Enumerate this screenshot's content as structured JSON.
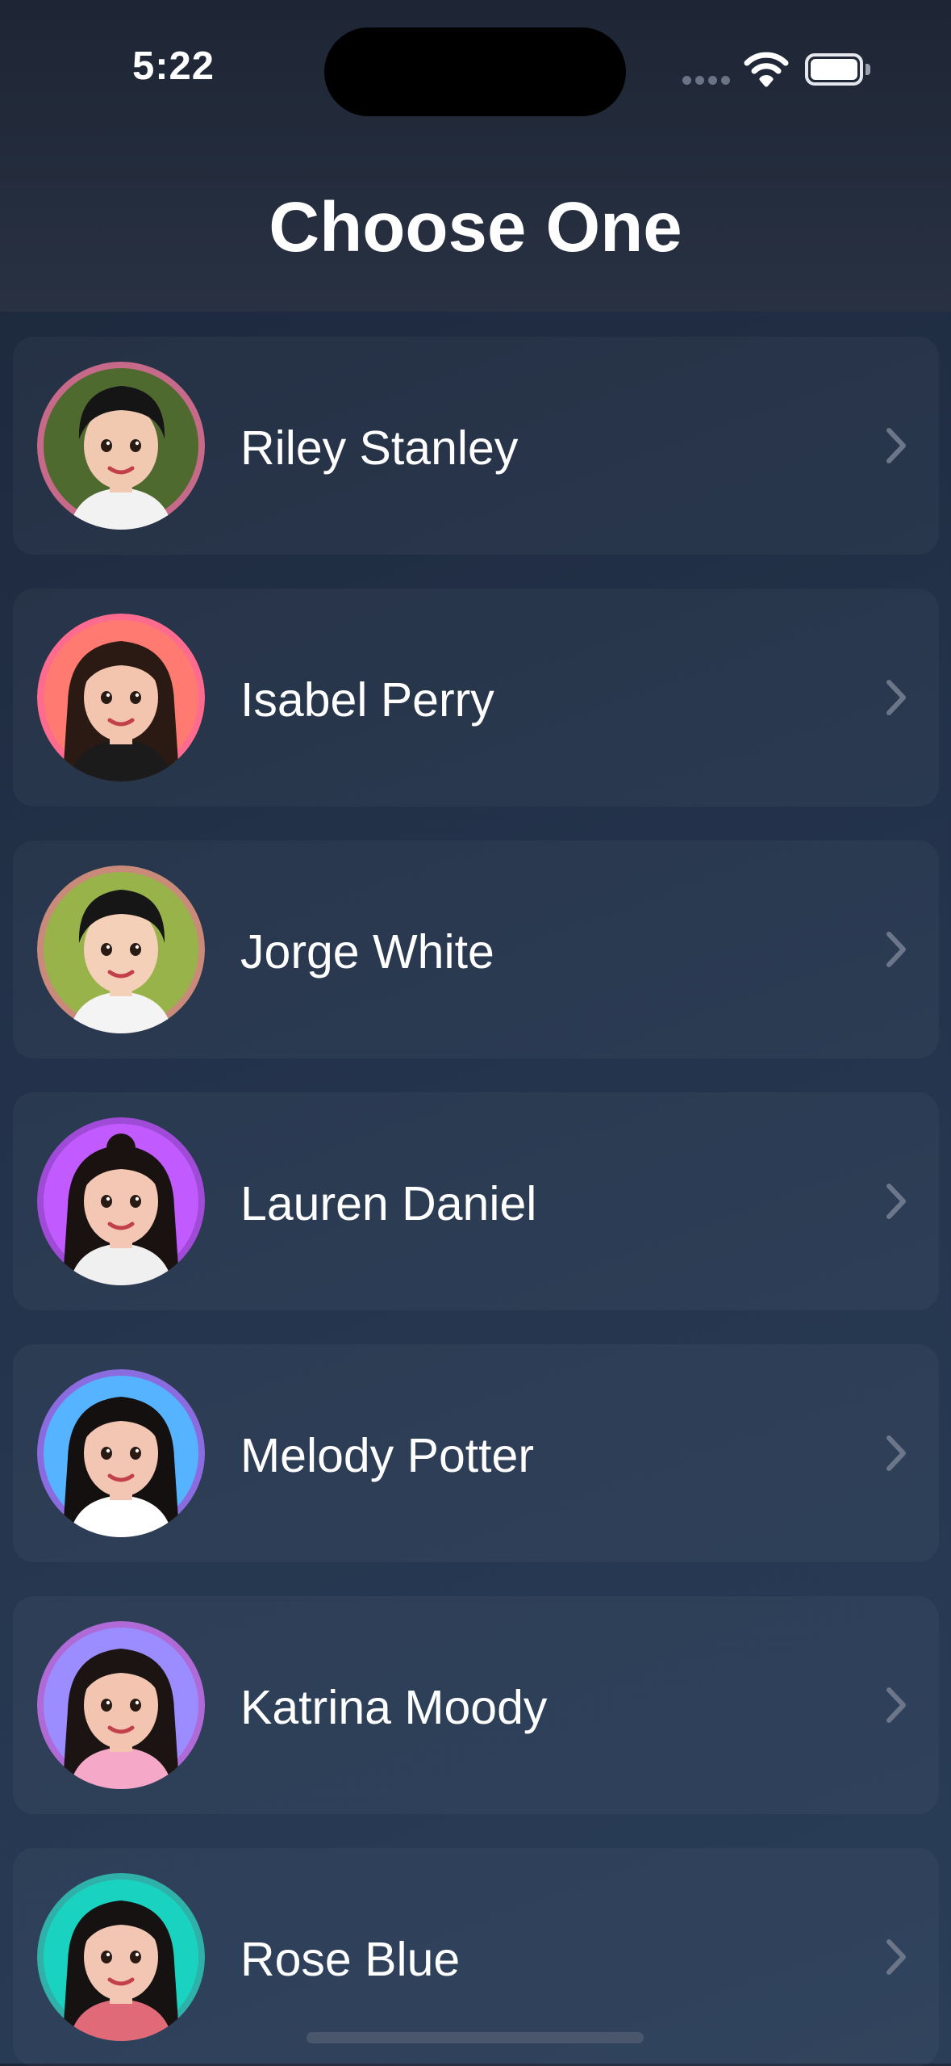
{
  "status_bar": {
    "time": "5:22"
  },
  "header": {
    "title": "Choose One"
  },
  "contacts": [
    {
      "name": "Riley Stanley",
      "avatar_bg": "#4f6a2e",
      "ring": "#c76a8a",
      "hair": "#151515",
      "skin": "#f1c9b0",
      "shirt": "#f2f2f2",
      "hair_style": "short"
    },
    {
      "name": "Isabel Perry",
      "avatar_bg": "#ff7a70",
      "ring": "#ff6a8f",
      "hair": "#2b1a14",
      "skin": "#f3c4ae",
      "shirt": "#1b1b1b",
      "hair_style": "long"
    },
    {
      "name": "Jorge White",
      "avatar_bg": "#97b34a",
      "ring": "#c98a7a",
      "hair": "#161616",
      "skin": "#f5d0b8",
      "shirt": "#f4f4f4",
      "hair_style": "short"
    },
    {
      "name": "Lauren Daniel",
      "avatar_bg": "#c25bff",
      "ring": "#a04bd8",
      "hair": "#1a1210",
      "skin": "#f3c7b4",
      "shirt": "#f0f0f0",
      "hair_style": "bun"
    },
    {
      "name": "Melody Potter",
      "avatar_bg": "#56b3ff",
      "ring": "#8a6be0",
      "hair": "#151010",
      "skin": "#f2c6b2",
      "shirt": "#ffffff",
      "hair_style": "long"
    },
    {
      "name": "Katrina Moody",
      "avatar_bg": "#9b8cff",
      "ring": "#b06ad8",
      "hair": "#1c1412",
      "skin": "#f3c5b0",
      "shirt": "#f6a8c8",
      "hair_style": "long"
    },
    {
      "name": "Rose Blue",
      "avatar_bg": "#19d3c0",
      "ring": "#2fb0a8",
      "hair": "#161212",
      "skin": "#f3c6b3",
      "shirt": "#e06a78",
      "hair_style": "long"
    }
  ]
}
